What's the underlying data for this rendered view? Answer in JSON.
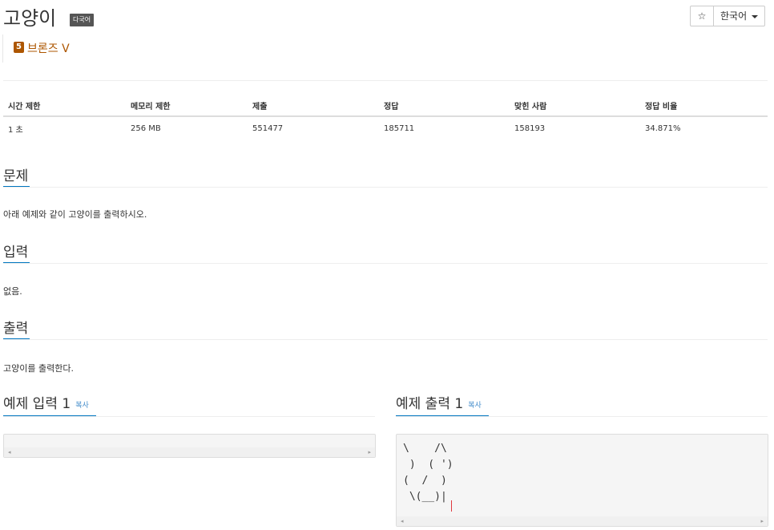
{
  "problem": {
    "title": "고양이",
    "multilang_badge": "다국어",
    "tier_number": "5",
    "tier_label": "브론즈 V"
  },
  "toolbar": {
    "star_glyph": "☆",
    "language": "한국어"
  },
  "stats": {
    "headers": [
      "시간 제한",
      "메모리 제한",
      "제출",
      "정답",
      "맞힌 사람",
      "정답 비율"
    ],
    "values": [
      "1 초",
      "256 MB",
      "551477",
      "185711",
      "158193",
      "34.871%"
    ]
  },
  "sections": {
    "description": {
      "title": "문제",
      "body": "아래 예제와 같이 고양이를 출력하시오."
    },
    "input": {
      "title": "입력",
      "body": "없음."
    },
    "output": {
      "title": "출력",
      "body": "고양이를 출력한다."
    }
  },
  "samples": {
    "input": {
      "title": "예제 입력 1",
      "copy_label": "복사",
      "content": ""
    },
    "output": {
      "title": "예제 출력 1",
      "copy_label": "복사",
      "content": "\\    /\\\n )  ( ')\n(  /  )\n \\(__)|"
    }
  },
  "colors": {
    "accent": "#0076c0",
    "bronze": "#ad5600",
    "link": "#428bca"
  }
}
